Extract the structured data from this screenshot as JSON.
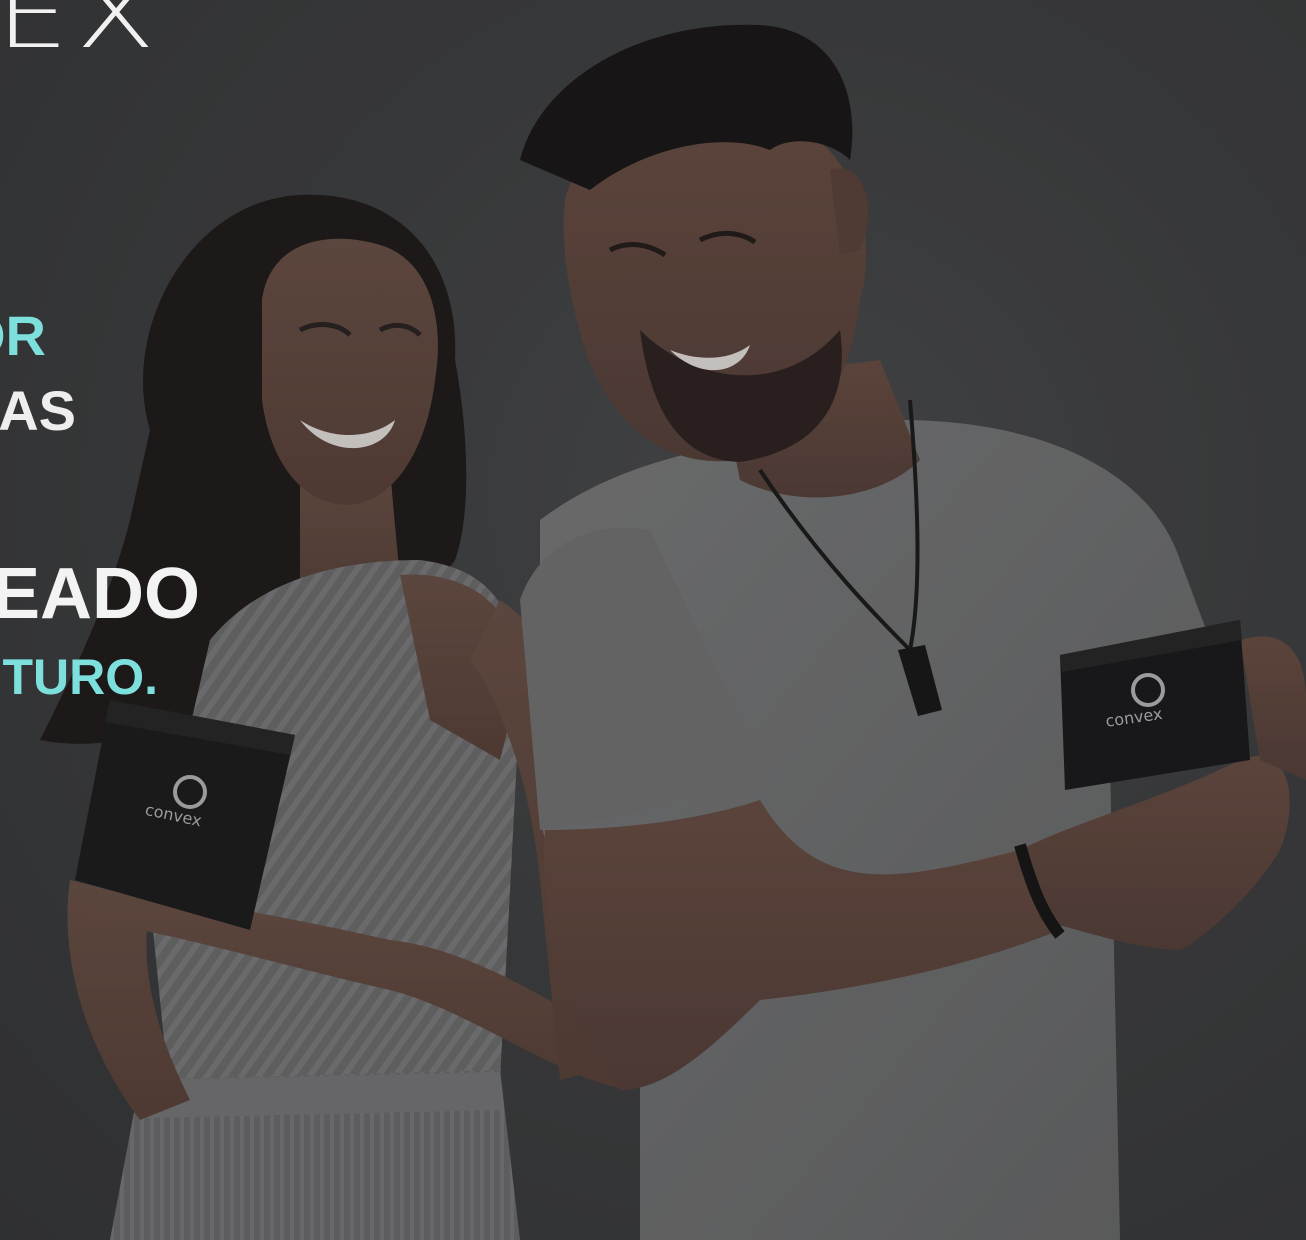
{
  "logo": {
    "text": "EX"
  },
  "headline": {
    "line1": "OR",
    "line2": "AS",
    "line3": "EADO",
    "line4": "TURO."
  },
  "product": {
    "box_brand": "CONVEX"
  },
  "colors": {
    "accent": "#7de0dc",
    "text_light": "#f1f1f1",
    "background": "#3f4042"
  },
  "icons": [
    "convex-logo-icon"
  ]
}
